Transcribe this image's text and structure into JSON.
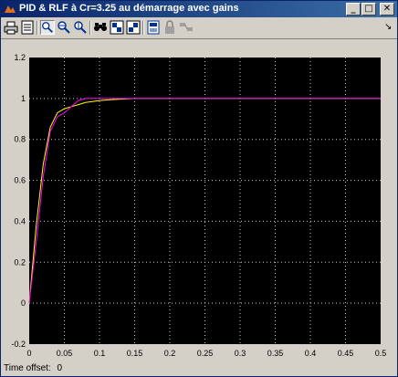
{
  "window": {
    "title": "PID & RLF à Cr=3.25 au démarrage avec gains",
    "accent_color": "#0a246a"
  },
  "titlebar_buttons": [
    {
      "name": "minimize",
      "glyph": "_"
    },
    {
      "name": "maximize",
      "glyph": "□"
    },
    {
      "name": "close",
      "glyph": "✕"
    }
  ],
  "toolbar": {
    "items": [
      "print-icon",
      "parameters-icon",
      "zoom-icon",
      "zoom-x-icon",
      "zoom-y-icon",
      "autoscale-icon",
      "save-axes-icon",
      "restore-axes-icon",
      "properties-icon",
      "lock-icon",
      "signal-selection-icon"
    ],
    "dock_glyph": "↘"
  },
  "status": {
    "time_offset_label": "Time offset:",
    "time_offset_value": "0"
  },
  "chart_data": {
    "type": "line",
    "title": "",
    "xlabel": "",
    "ylabel": "",
    "xlim": [
      0,
      0.5
    ],
    "ylim": [
      -0.2,
      1.2
    ],
    "x_ticks": [
      "0",
      "0.05",
      "0.1",
      "0.15",
      "0.2",
      "0.25",
      "0.3",
      "0.35",
      "0.4",
      "0.45",
      "0.5"
    ],
    "y_ticks": [
      "-0.2",
      "0",
      "0.2",
      "0.4",
      "0.6",
      "0.8",
      "1",
      "1.2"
    ],
    "grid": true,
    "background": "#000000",
    "series": [
      {
        "color": "#ffff00",
        "x": [
          0,
          0.01,
          0.02,
          0.03,
          0.04,
          0.05,
          0.06,
          0.07,
          0.08,
          0.09,
          0.1,
          0.12,
          0.15,
          0.2,
          0.3,
          0.5
        ],
        "y": [
          0,
          0.38,
          0.68,
          0.86,
          0.93,
          0.95,
          0.96,
          0.97,
          0.98,
          0.985,
          0.99,
          0.995,
          1.0,
          1.0,
          1.0,
          1.0
        ]
      },
      {
        "color": "#ff00ff",
        "x": [
          0,
          0.01,
          0.02,
          0.03,
          0.04,
          0.05,
          0.06,
          0.07,
          0.08,
          0.09,
          0.1,
          0.15,
          0.2,
          0.3,
          0.5
        ],
        "y": [
          0,
          0.3,
          0.62,
          0.84,
          0.91,
          0.93,
          0.96,
          0.99,
          1.0,
          1.0,
          1.0,
          1.0,
          1.0,
          1.0,
          1.0
        ]
      }
    ]
  }
}
